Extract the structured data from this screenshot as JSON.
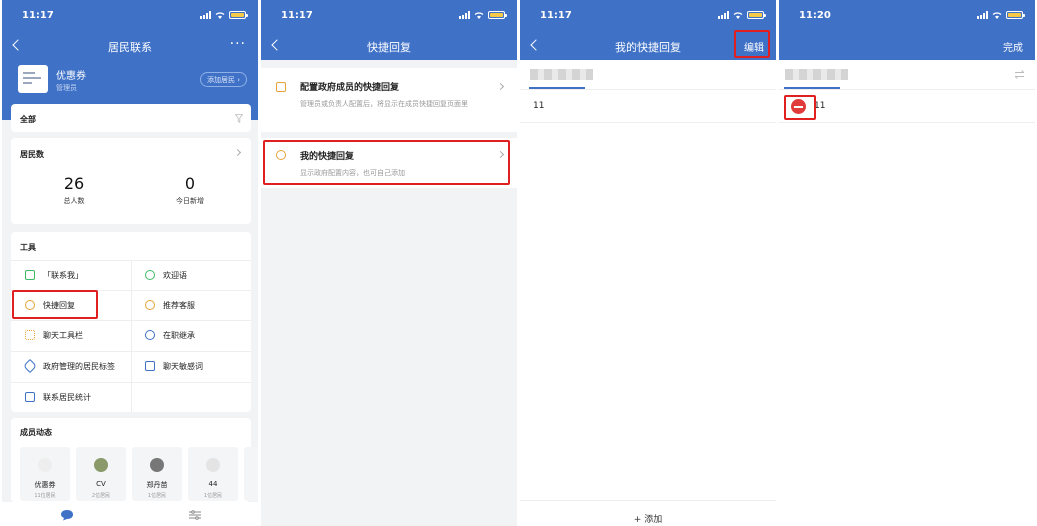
{
  "status": {
    "time_1": "11:17",
    "time_2": "11:17",
    "time_3": "11:17",
    "time_4": "11:20"
  },
  "screen1": {
    "nav_title": "居民联系",
    "more": "···",
    "org_name": "优惠券",
    "org_role": "管理员",
    "add_resident": "添加居民 ›",
    "filter_all": "全部",
    "residents_title": "居民数",
    "stats": [
      {
        "value": "26",
        "label": "总人数"
      },
      {
        "value": "0",
        "label": "今日新增"
      }
    ],
    "tools_title": "工具",
    "tools": [
      {
        "label": "「联系我」",
        "icon": "contact-me-icon"
      },
      {
        "label": "欢迎语",
        "icon": "welcome-icon"
      },
      {
        "label": "快捷回复",
        "icon": "quick-reply-icon"
      },
      {
        "label": "推荐客服",
        "icon": "recommend-service-icon"
      },
      {
        "label": "聊天工具栏",
        "icon": "chat-toolbar-icon"
      },
      {
        "label": "在职继承",
        "icon": "inheritance-icon"
      },
      {
        "label": "政府管理的居民标签",
        "icon": "tag-icon"
      },
      {
        "label": "聊天敏感词",
        "icon": "sensitive-word-icon"
      },
      {
        "label": "联系居民统计",
        "icon": "statistics-icon"
      }
    ],
    "members_title": "成员动态",
    "members": [
      {
        "name": "优惠券",
        "sub": "11位居民"
      },
      {
        "name": "CV",
        "sub": "2位居民"
      },
      {
        "name": "郑丹苗",
        "sub": "1位居民"
      },
      {
        "name": "44",
        "sub": "1位居民"
      }
    ]
  },
  "screen2": {
    "nav_title": "快捷回复",
    "items": [
      {
        "title": "配置政府成员的快捷回复",
        "desc": "管理员或负责人配置后，将显示在成员快捷回复页面里"
      },
      {
        "title": "我的快捷回复",
        "desc": "显示政府配置内容，也可自己添加"
      }
    ]
  },
  "screen3": {
    "nav_title": "我的快捷回复",
    "edit": "编辑",
    "reply_item": "11",
    "add": "添加"
  },
  "screen4": {
    "done": "完成",
    "reply_item": "11"
  },
  "colors": {
    "primary": "#3f71c7",
    "highlight": "#e02020",
    "delete": "#e03a3a"
  }
}
